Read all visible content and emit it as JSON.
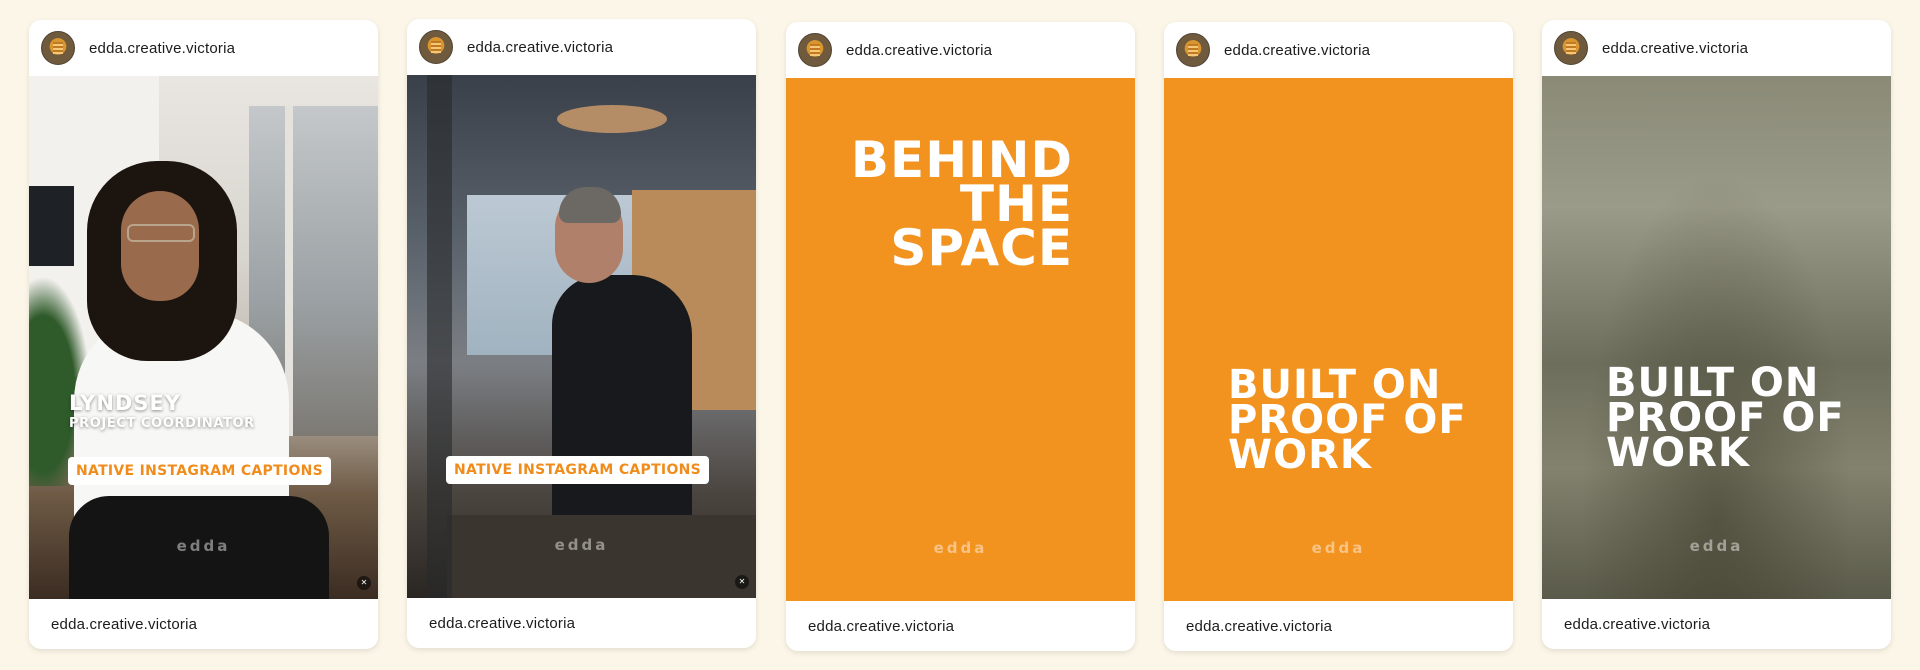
{
  "posts": [
    {
      "header_handle": "edda.creative.victoria",
      "footer_handle": "edda.creative.victoria",
      "caption_name": "LYNDSEY",
      "caption_role": "PROJECT COORDINATOR",
      "caption_pill": "NATIVE INSTAGRAM CAPTIONS",
      "logo_text": "edda",
      "mute_icon": "muted-speaker-icon"
    },
    {
      "header_handle": "edda.creative.victoria",
      "footer_handle": "edda.creative.victoria",
      "caption_pill": "NATIVE INSTAGRAM CAPTIONS",
      "logo_text": "edda",
      "mute_icon": "muted-speaker-icon"
    },
    {
      "header_handle": "edda.creative.victoria",
      "footer_handle": "edda.creative.victoria",
      "headline": [
        "BEHIND",
        "THE",
        "SPACE"
      ],
      "logo_text": "edda"
    },
    {
      "header_handle": "edda.creative.victoria",
      "footer_handle": "edda.creative.victoria",
      "headline": [
        "BUILT ON",
        "PROOF OF",
        "WORK"
      ],
      "logo_text": "edda"
    },
    {
      "header_handle": "edda.creative.victoria",
      "footer_handle": "edda.creative.victoria",
      "headline": [
        "BUILT ON",
        "PROOF OF",
        "WORK"
      ],
      "logo_text": "edda"
    }
  ],
  "colors": {
    "page_background": "#fcf6e8",
    "brand_orange": "#f29320",
    "card_background": "#ffffff"
  }
}
